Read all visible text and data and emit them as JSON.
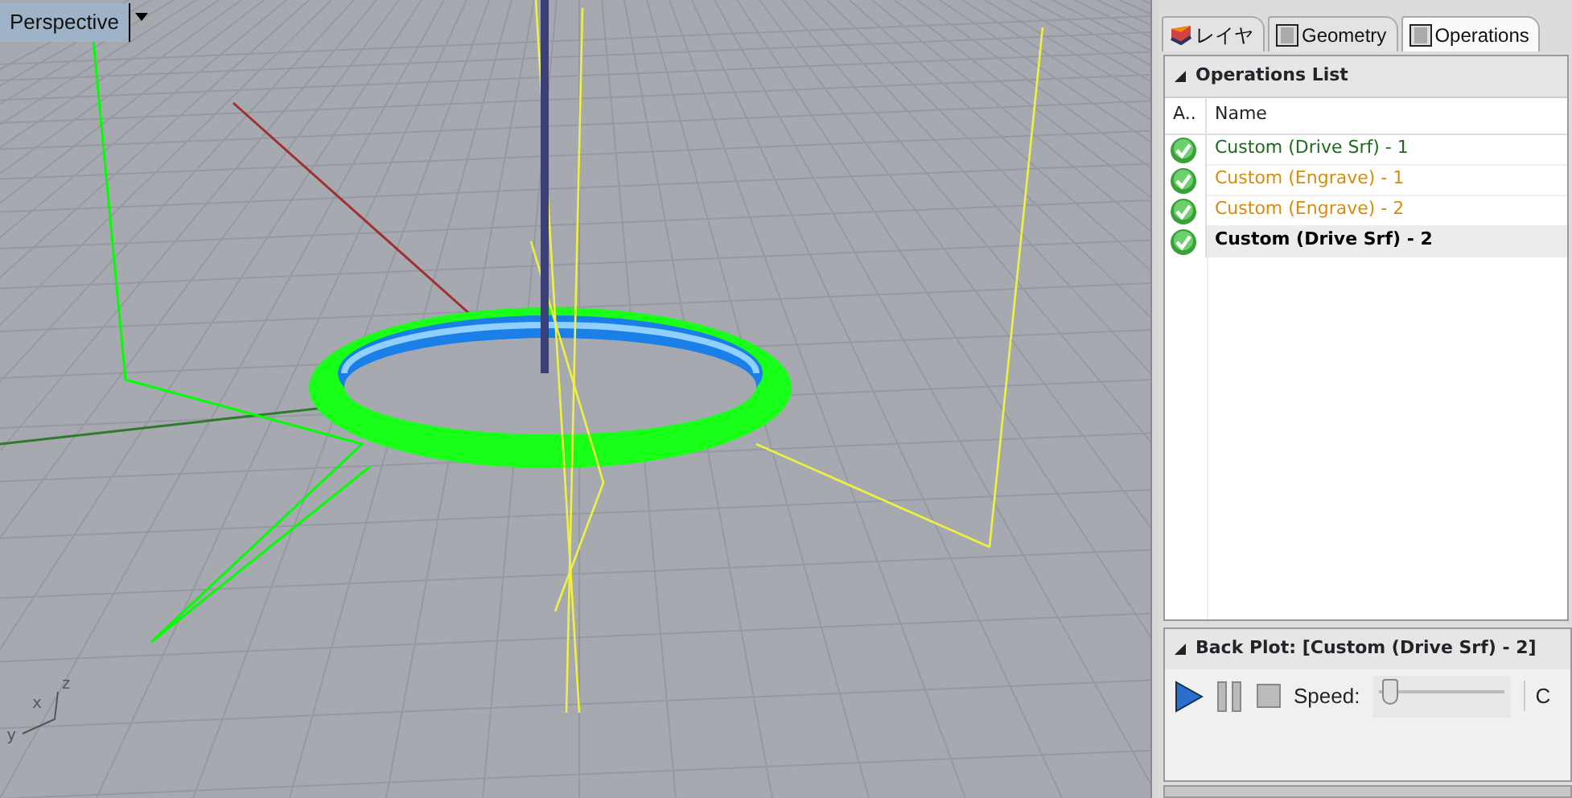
{
  "viewport": {
    "title": "Perspective",
    "axis_labels": [
      "z",
      "x",
      "y"
    ]
  },
  "tabs": [
    {
      "label": "レイヤ",
      "kind": "layer",
      "selected": false
    },
    {
      "label": "Geometry",
      "kind": "panel",
      "selected": false
    },
    {
      "label": "Operations",
      "kind": "panel",
      "selected": true
    }
  ],
  "operations_list": {
    "title": "Operations List",
    "columns": [
      "A..",
      "Name"
    ],
    "rows": [
      {
        "name": "Custom (Drive Srf) - 1",
        "color": "#1e6b1e",
        "selected": false
      },
      {
        "name": "Custom (Engrave) - 1",
        "color": "#d98c0a",
        "selected": false
      },
      {
        "name": "Custom (Engrave) - 2",
        "color": "#d98c0a",
        "selected": false
      },
      {
        "name": "Custom (Drive Srf) - 2",
        "color": "#000000",
        "selected": true
      }
    ]
  },
  "back_plot": {
    "title": "Back Plot: [Custom (Drive Srf) - 2]",
    "speed_label": "Speed:",
    "speed": {
      "level": 0.03
    },
    "column_3": "C"
  }
}
